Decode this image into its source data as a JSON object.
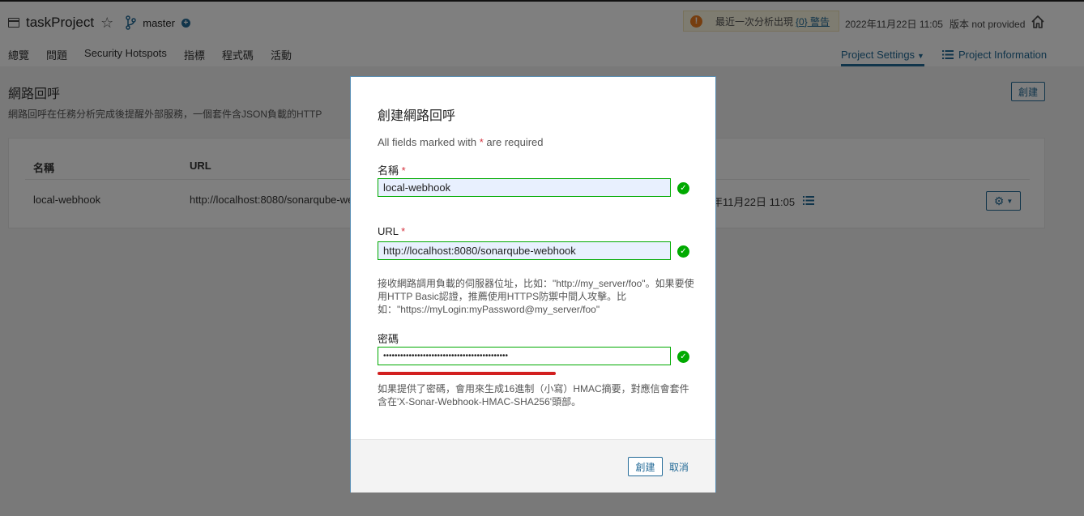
{
  "header": {
    "project_name": "taskProject",
    "branch": "master",
    "warning_text": "最近一次分析出現",
    "warning_link": "{0} 警告",
    "analysis_date": "2022年11月22日 11:05",
    "version": "版本 not provided",
    "nav": [
      "總覽",
      "問題",
      "Security Hotspots",
      "指標",
      "程式碼",
      "活動"
    ],
    "project_settings": "Project Settings",
    "project_information": "Project Information"
  },
  "page": {
    "title": "網路回呼",
    "description": "網路回呼在任務分析完成後提醒外部服務，一個套件含JSON負載的HTTP",
    "create_button": "創建",
    "table": {
      "headers": [
        "名稱",
        "URL"
      ],
      "rows": [
        {
          "name": "local-webhook",
          "url": "http://localhost:8080/sonarqube-we",
          "last_delivery": "年11月22日 11:05"
        }
      ]
    }
  },
  "modal": {
    "title": "創建網路回呼",
    "required_note_before": "All fields marked with",
    "required_star": "*",
    "required_note_after": "are required",
    "name_label": "名稱",
    "name_value": "local-webhook",
    "url_label": "URL",
    "url_value": "http://localhost:8080/sonarqube-webhook",
    "url_help": "接收網路調用負載的伺服器位址，比如：\"http://my_server/foo\"。如果要使用HTTP Basic認證，推薦使用HTTPS防禦中間人攻擊。比如：\"https://myLogin:myPassword@my_server/foo\"",
    "secret_label": "密碼",
    "secret_value": "••••••••••••••••••••••••••••••••••••••••••••",
    "secret_help": "如果提供了密碼，會用來生成16進制（小寫）HMAC摘要，對應信會套件含在'X-Sonar-Webhook-HMAC-SHA256'頭部。",
    "create_button": "創建",
    "cancel_button": "取消"
  },
  "colors": {
    "accent": "#236a97",
    "success": "#00aa00",
    "warning": "#ed7d20",
    "required": "#d4333f"
  }
}
